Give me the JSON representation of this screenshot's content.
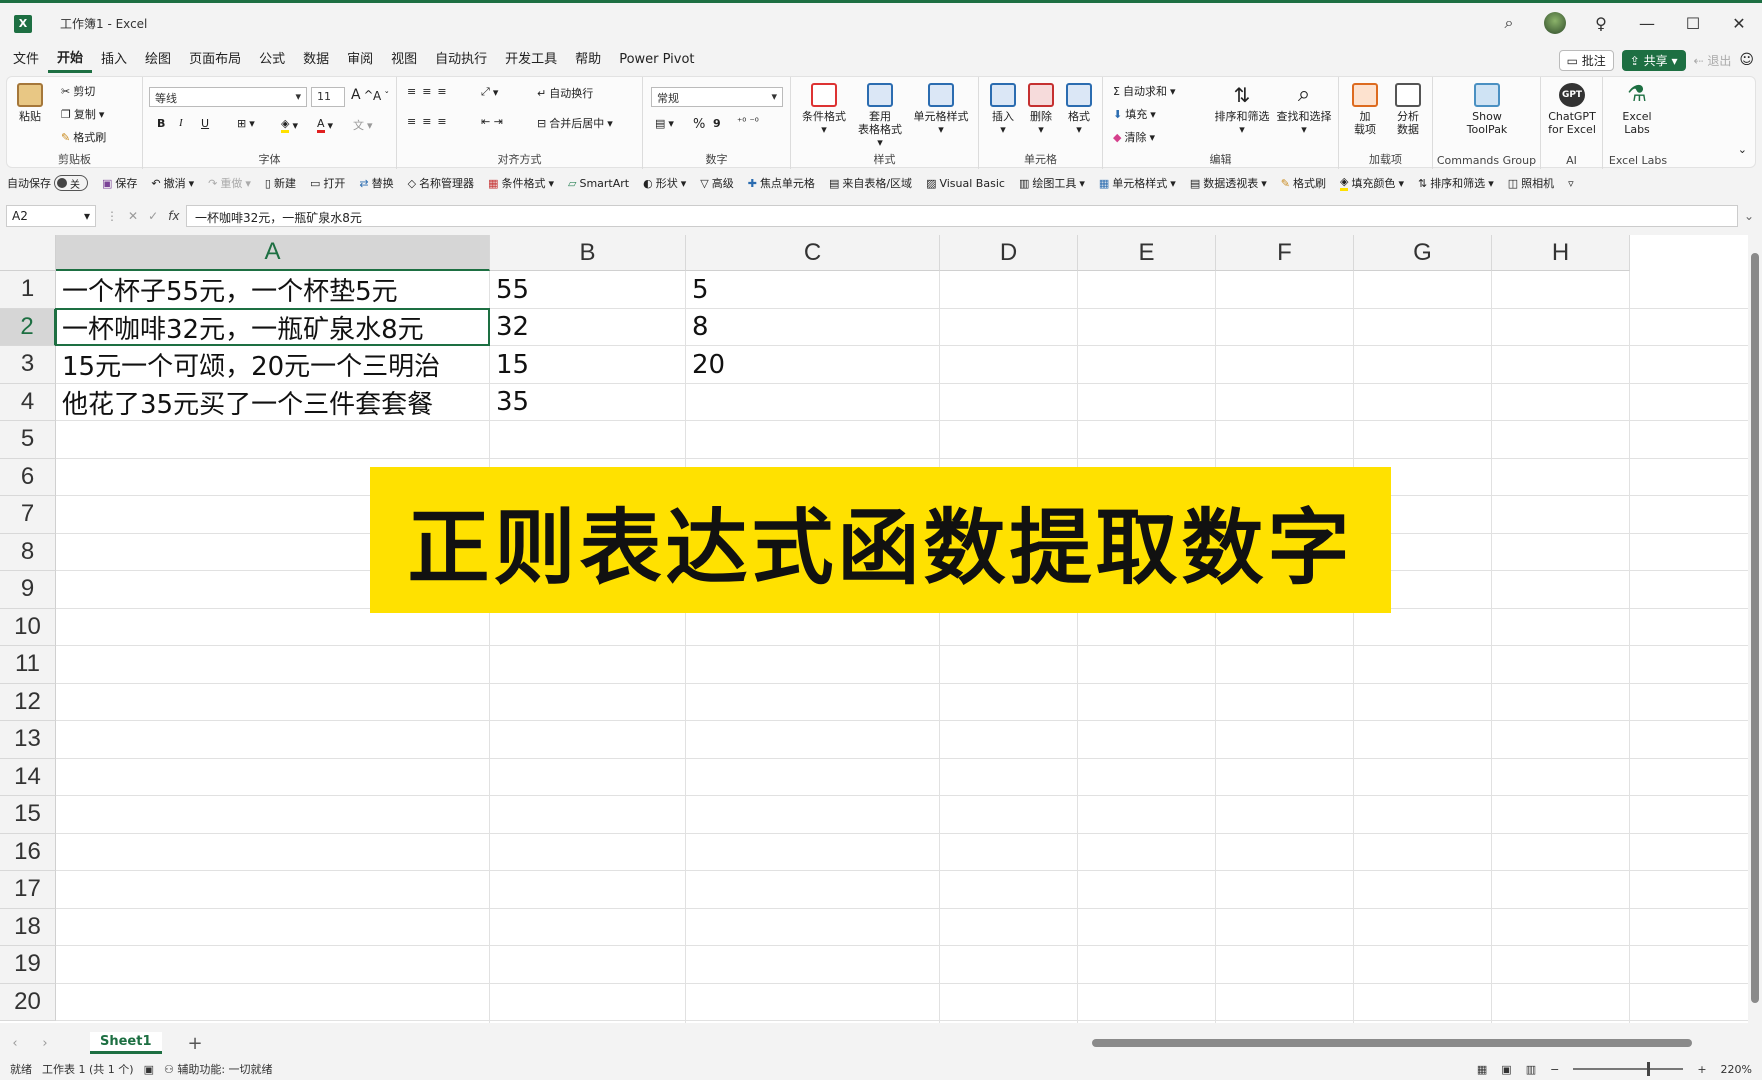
{
  "window": {
    "title": "工作簿1  -  Excel",
    "app_icon": "X"
  },
  "menu": {
    "tabs": [
      "文件",
      "开始",
      "插入",
      "绘图",
      "页面布局",
      "公式",
      "数据",
      "审阅",
      "视图",
      "自动执行",
      "开发工具",
      "帮助",
      "Power Pivot"
    ],
    "active": "开始",
    "comment": "批注",
    "share": "共享",
    "exit": "退出"
  },
  "ribbon": {
    "clipboard": {
      "paste": "粘贴",
      "cut": "剪切",
      "copy": "复制",
      "format_painter": "格式刷",
      "label": "剪贴板"
    },
    "font": {
      "name": "等线",
      "size": "11",
      "bold": "B",
      "italic": "I",
      "underline": "U",
      "label": "字体"
    },
    "alignment": {
      "wrap": "自动换行",
      "merge": "合并后居中",
      "label": "对齐方式"
    },
    "number": {
      "format": "常规",
      "percent": "%",
      "comma": "9",
      "label": "数字"
    },
    "styles": {
      "conditional": "条件格式",
      "table_top": "套用",
      "table_bottom": "表格格式",
      "cell_styles": "单元格样式",
      "label": "样式"
    },
    "cells": {
      "insert": "插入",
      "delete": "删除",
      "format": "格式",
      "label": "单元格"
    },
    "editing": {
      "autosum": "自动求和",
      "fill": "填充",
      "clear": "清除",
      "sort": "排序和筛选",
      "find": "查找和选择",
      "label": "编辑"
    },
    "addins": {
      "addins_top": "加",
      "addins_bottom": "载项",
      "analyze_top": "分析",
      "analyze_bottom": "数据",
      "label": "加载项"
    },
    "commands": {
      "show_top": "Show",
      "show_bottom": "ToolPak",
      "label": "Commands Group"
    },
    "ai": {
      "badge": "GPT",
      "gpt_top": "ChatGPT",
      "gpt_bottom": "for Excel",
      "label": "AI"
    },
    "labs": {
      "labs_top": "Excel",
      "labs_bottom": "Labs",
      "label": "Excel Labs"
    }
  },
  "qat": {
    "autosave": "自动保存",
    "autosave_state": "关",
    "items": [
      "保存",
      "撤消",
      "重做",
      "新建",
      "打开",
      "替换",
      "名称管理器",
      "条件格式",
      "SmartArt",
      "形状",
      "高级",
      "焦点单元格",
      "来自表格/区域",
      "Visual Basic",
      "绘图工具",
      "单元格样式",
      "数据透视表",
      "格式刷",
      "填充颜色",
      "排序和筛选",
      "照相机"
    ]
  },
  "formula_bar": {
    "name_box": "A2",
    "fx": "fx",
    "content": "一杯咖啡32元，一瓶矿泉水8元"
  },
  "grid": {
    "columns": [
      "A",
      "B",
      "C",
      "D",
      "E",
      "F",
      "G",
      "H"
    ],
    "rows": [
      "1",
      "2",
      "3",
      "4",
      "5",
      "6",
      "7",
      "8",
      "9",
      "10",
      "11",
      "12",
      "13",
      "14",
      "15",
      "16",
      "17",
      "18",
      "19",
      "20"
    ],
    "cells": {
      "A1": "一个杯子55元，一个杯垫5元",
      "B1": "55",
      "C1": "5",
      "A2": "一杯咖啡32元，一瓶矿泉水8元",
      "B2": "32",
      "C2": "8",
      "A3": "15元一个可颂，20元一个三明治",
      "B3": "15",
      "C3": "20",
      "A4": "他花了35元买了一个三件套套餐",
      "B4": "35"
    },
    "selected": "A2"
  },
  "banner": {
    "text": "正则表达式函数提取数字",
    "color": "#ffe100"
  },
  "sheets": {
    "tabs": [
      "Sheet1"
    ],
    "active": "Sheet1",
    "add": "+"
  },
  "status": {
    "ready": "就绪",
    "sheet_count": "工作表 1 (共 1 个)",
    "accessibility": "辅助功能: 一切就绪",
    "zoom": "220%"
  },
  "colors": {
    "accent": "#1d6f42"
  }
}
